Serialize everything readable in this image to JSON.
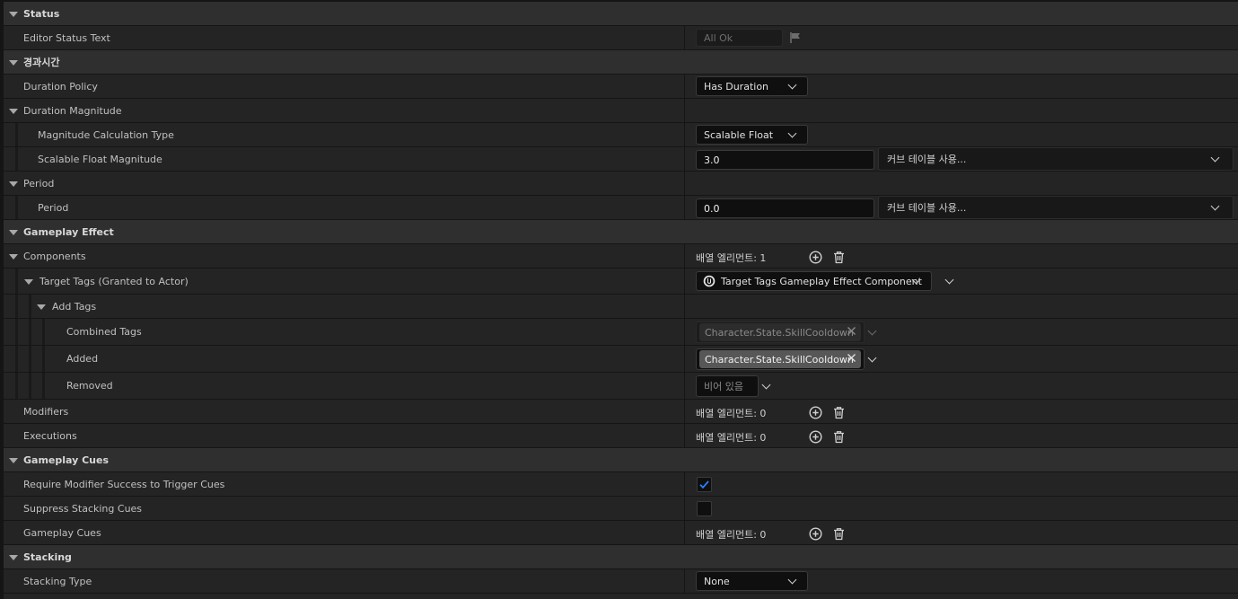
{
  "sections": {
    "status": {
      "title": "Status",
      "editor_status_label": "Editor Status Text",
      "editor_status_value": "All Ok"
    },
    "duration": {
      "title": "경과시간",
      "duration_policy_label": "Duration Policy",
      "duration_policy_value": "Has Duration",
      "duration_magnitude_label": "Duration Magnitude",
      "magnitude_calc_label": "Magnitude Calculation Type",
      "magnitude_calc_value": "Scalable Float",
      "scalable_float_label": "Scalable Float Magnitude",
      "scalable_float_value": "3.0",
      "curve_table_placeholder": "커브 테이블 사용...",
      "period_group_label": "Period",
      "period_label": "Period",
      "period_value": "0.0"
    },
    "gameplay_effect": {
      "title": "Gameplay Effect",
      "components_label": "Components",
      "components_count": "배열 엘리먼트: 1",
      "target_tags_label": "Target Tags (Granted to Actor)",
      "target_tags_component": "Target Tags Gameplay Effect Component",
      "add_tags_label": "Add Tags",
      "combined_tags_label": "Combined Tags",
      "combined_tag": "Character.State.SkillCooldown",
      "added_label": "Added",
      "added_tag": "Character.State.SkillCooldown",
      "removed_label": "Removed",
      "removed_placeholder": "비어 있음",
      "modifiers_label": "Modifiers",
      "modifiers_count": "배열 엘리먼트: 0",
      "executions_label": "Executions",
      "executions_count": "배열 엘리먼트: 0"
    },
    "gameplay_cues": {
      "title": "Gameplay Cues",
      "require_modifier_label": "Require Modifier Success to Trigger Cues",
      "require_modifier_checked": true,
      "suppress_stacking_label": "Suppress Stacking Cues",
      "suppress_stacking_checked": false,
      "cues_label": "Gameplay Cues",
      "cues_count": "배열 엘리먼트: 0"
    },
    "stacking": {
      "title": "Stacking",
      "stacking_type_label": "Stacking Type",
      "stacking_type_value": "None"
    }
  },
  "colors": {
    "check_accent": "#2a7fff",
    "tag_active_bg": "#575757",
    "tag_inactive_bg": "#2c2c2c"
  },
  "icons": {
    "add": "plus-circle-icon",
    "delete": "trash-icon",
    "reset": "flag-icon",
    "component": "unreal-logo-icon"
  }
}
